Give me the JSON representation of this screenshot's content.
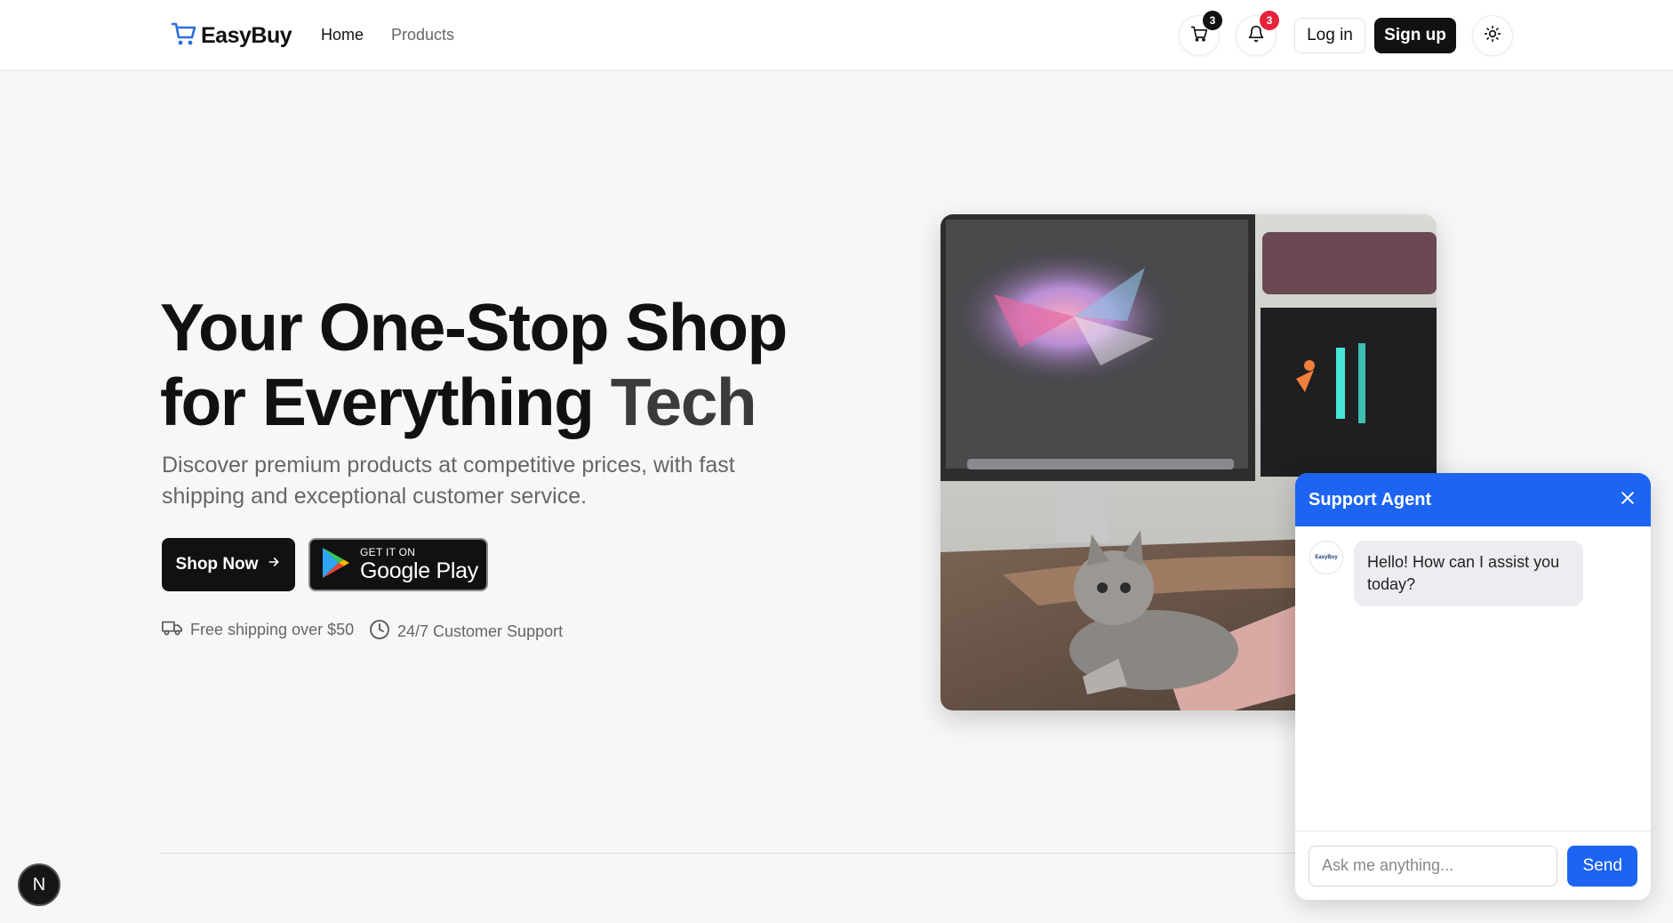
{
  "header": {
    "brand": "EasyBuy",
    "nav": {
      "home": "Home",
      "products": "Products"
    },
    "cart_count": "3",
    "notification_count": "3",
    "login": "Log in",
    "signup": "Sign up"
  },
  "hero": {
    "title_line1": "Your One-Stop Shop",
    "title_line2_a": "for Everything ",
    "title_line2_b": "Tech",
    "subtitle": "Discover premium products at competitive prices, with fast shipping and exceptional customer service.",
    "shop_now": "Shop Now",
    "google_play_small": "GET IT ON",
    "google_play_big": "Google Play",
    "feature_shipping": "Free shipping over $50",
    "feature_support": "24/7 Customer Support"
  },
  "chat": {
    "title": "Support Agent",
    "avatar_text": "EasyBuy",
    "greeting": "Hello! How can I assist you today?",
    "input_placeholder": "Ask me anything...",
    "send": "Send"
  },
  "dev_badge": "N",
  "colors": {
    "accent": "#1d64f2",
    "dark": "#111111",
    "badge_red": "#e5243b"
  },
  "icons": [
    "cart-icon",
    "bell-icon",
    "sun-icon",
    "arrow-right-icon",
    "google-play-icon",
    "truck-icon",
    "clock-icon",
    "close-icon"
  ]
}
